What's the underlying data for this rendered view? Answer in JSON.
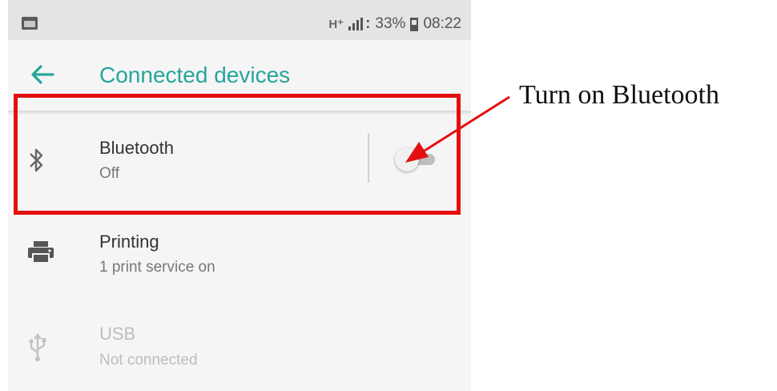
{
  "status_bar": {
    "network": "H⁺",
    "battery": "33%",
    "time": "08:22"
  },
  "header": {
    "title": "Connected devices",
    "back_icon": "arrow-left-icon"
  },
  "settings": [
    {
      "id": "bluetooth",
      "icon": "bluetooth-icon",
      "title": "Bluetooth",
      "subtitle": "Off",
      "toggle": "off"
    },
    {
      "id": "printing",
      "icon": "printer-icon",
      "title": "Printing",
      "subtitle": "1 print service on"
    },
    {
      "id": "usb",
      "icon": "usb-icon",
      "title": "USB",
      "subtitle": "Not connected",
      "disabled": true
    }
  ],
  "annotation": {
    "text": "Turn on Bluetooth",
    "color": "#e41010"
  },
  "colors": {
    "accent": "#26a69a",
    "highlight": "#e41010"
  }
}
